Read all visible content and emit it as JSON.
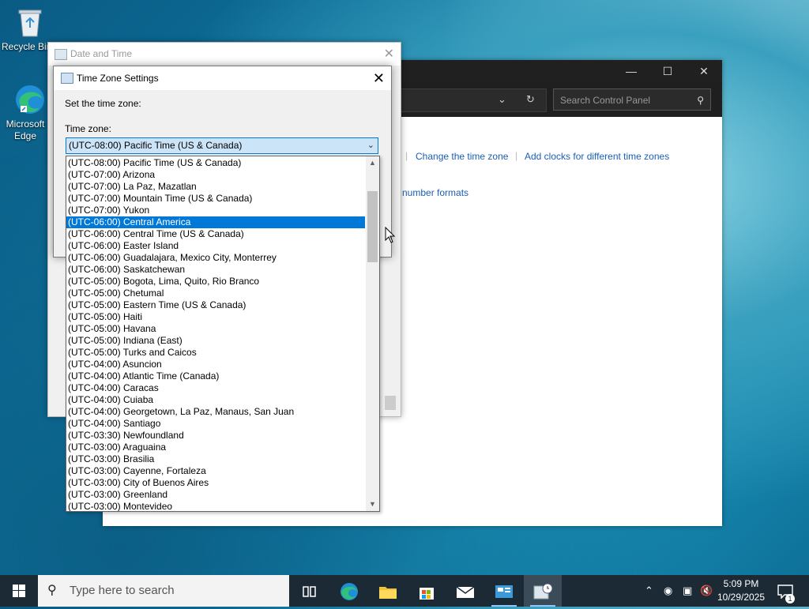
{
  "desktop": {
    "icons": [
      {
        "label": "Recycle Bin",
        "icon": "recycle-bin-icon"
      },
      {
        "label": "Microsoft Edge",
        "icon": "edge-icon"
      }
    ]
  },
  "control_panel": {
    "search_placeholder": "Search Control Panel",
    "links": {
      "change_time_zone": "Change the time zone",
      "add_clocks": "Add clocks for different time zones",
      "number_formats": "number formats"
    }
  },
  "date_time_dialog": {
    "title": "Date and Time"
  },
  "time_zone_dialog": {
    "title": "Time Zone Settings",
    "set_label": "Set the time zone:",
    "time_zone_label": "Time zone:",
    "selected_value": "(UTC-08:00) Pacific Time (US & Canada)",
    "highlighted_option": "(UTC-06:00) Central America",
    "options": [
      "(UTC-08:00) Pacific Time (US & Canada)",
      "(UTC-07:00) Arizona",
      "(UTC-07:00) La Paz, Mazatlan",
      "(UTC-07:00) Mountain Time (US & Canada)",
      "(UTC-07:00) Yukon",
      "(UTC-06:00) Central America",
      "(UTC-06:00) Central Time (US & Canada)",
      "(UTC-06:00) Easter Island",
      "(UTC-06:00) Guadalajara, Mexico City, Monterrey",
      "(UTC-06:00) Saskatchewan",
      "(UTC-05:00) Bogota, Lima, Quito, Rio Branco",
      "(UTC-05:00) Chetumal",
      "(UTC-05:00) Eastern Time (US & Canada)",
      "(UTC-05:00) Haiti",
      "(UTC-05:00) Havana",
      "(UTC-05:00) Indiana (East)",
      "(UTC-05:00) Turks and Caicos",
      "(UTC-04:00) Asuncion",
      "(UTC-04:00) Atlantic Time (Canada)",
      "(UTC-04:00) Caracas",
      "(UTC-04:00) Cuiaba",
      "(UTC-04:00) Georgetown, La Paz, Manaus, San Juan",
      "(UTC-04:00) Santiago",
      "(UTC-03:30) Newfoundland",
      "(UTC-03:00) Araguaina",
      "(UTC-03:00) Brasilia",
      "(UTC-03:00) Cayenne, Fortaleza",
      "(UTC-03:00) City of Buenos Aires",
      "(UTC-03:00) Greenland",
      "(UTC-03:00) Montevideo"
    ]
  },
  "taskbar": {
    "search_placeholder": "Type here to search",
    "apps": [
      "task-view-icon",
      "edge-icon",
      "file-explorer-icon",
      "store-icon",
      "mail-icon",
      "control-panel-icon",
      "date-time-icon"
    ],
    "clock_time": "5:09 PM",
    "clock_date": "10/29/2025",
    "notification_count": "1"
  },
  "colors": {
    "accent": "#0078d7",
    "link": "#1a5fb4",
    "taskbar": "#1b2a35"
  }
}
